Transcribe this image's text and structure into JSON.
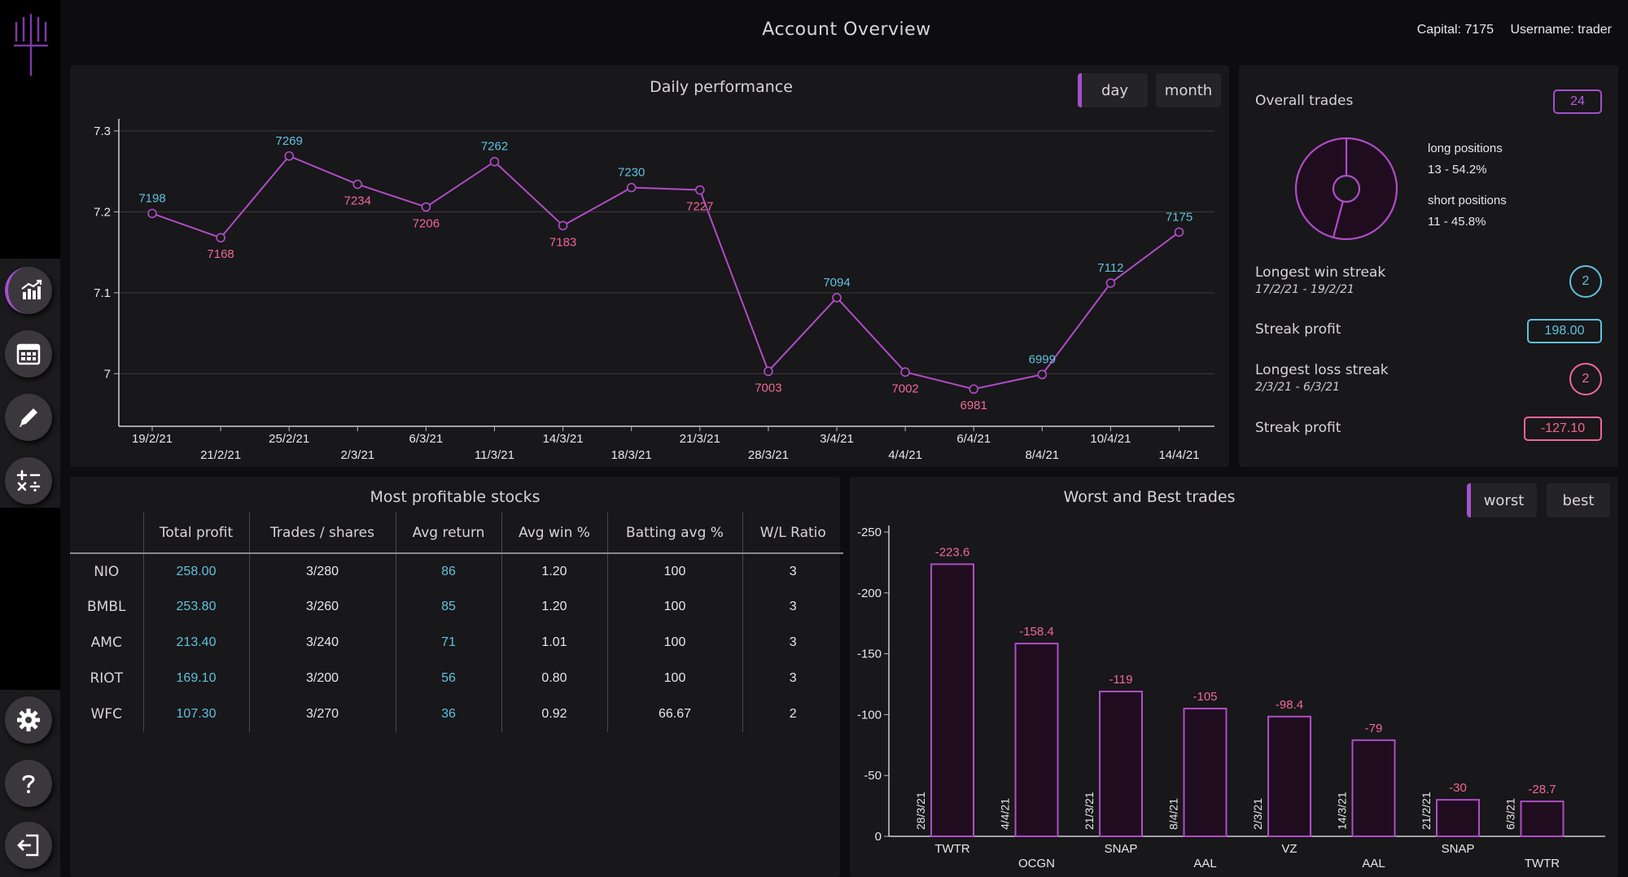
{
  "header": {
    "title": "Account Overview",
    "capital": "Capital: 7175",
    "username": "Username: trader"
  },
  "colors": {
    "accent": "#a44fd0",
    "line": "#b04cc8",
    "positive": "#5ec3e0",
    "negative": "#f0679a",
    "panel": "#181719"
  },
  "sidebar": {
    "items": [
      {
        "icon": "chart-icon",
        "active": true
      },
      {
        "icon": "calendar-icon",
        "active": false
      },
      {
        "icon": "pencil-icon",
        "active": false
      },
      {
        "icon": "calculator-icon",
        "active": false
      },
      {
        "icon": "gear-icon",
        "active": false
      },
      {
        "icon": "help-icon",
        "active": false
      },
      {
        "icon": "logout-icon",
        "active": false
      }
    ]
  },
  "daily": {
    "title": "Daily performance",
    "toggle_day": "day",
    "toggle_month": "month"
  },
  "summary": {
    "overall_label": "Overall trades",
    "overall_value": "24",
    "long_label": "long positions",
    "long_value": "13 - 54.2%",
    "short_label": "short positions",
    "short_value": "11 - 45.8%",
    "win_label": "Longest win streak",
    "win_dates": "17/2/21 - 19/2/21",
    "win_count": "2",
    "win_profit_label": "Streak profit",
    "win_profit": "198.00",
    "loss_label": "Longest loss streak",
    "loss_dates": "2/3/21 - 6/3/21",
    "loss_count": "2",
    "loss_profit_label": "Streak profit",
    "loss_profit": "-127.10"
  },
  "stocks": {
    "title": "Most profitable stocks",
    "columns": [
      "",
      "Total profit",
      "Trades / shares",
      "Avg return",
      "Avg win %",
      "Batting avg %",
      "W/L Ratio"
    ],
    "rows": [
      [
        "NIO",
        "258.00",
        "3/280",
        "86",
        "1.20",
        "100",
        "3"
      ],
      [
        "BMBL",
        "253.80",
        "3/260",
        "85",
        "1.20",
        "100",
        "3"
      ],
      [
        "AMC",
        "213.40",
        "3/240",
        "71",
        "1.01",
        "100",
        "3"
      ],
      [
        "RIOT",
        "169.10",
        "3/200",
        "56",
        "0.80",
        "100",
        "3"
      ],
      [
        "WFC",
        "107.30",
        "3/270",
        "36",
        "0.92",
        "66.67",
        "2"
      ]
    ]
  },
  "trades": {
    "title": "Worst and Best trades",
    "toggle_worst": "worst",
    "toggle_best": "best"
  },
  "chart_data": [
    {
      "type": "line",
      "title": "Daily performance",
      "x": [
        "19/2/21",
        "21/2/21",
        "25/2/21",
        "2/3/21",
        "6/3/21",
        "11/3/21",
        "14/3/21",
        "18/3/21",
        "21/3/21",
        "28/3/21",
        "3/4/21",
        "4/4/21",
        "6/4/21",
        "8/4/21",
        "10/4/21",
        "14/4/21"
      ],
      "values": [
        7198,
        7168,
        7269,
        7234,
        7206,
        7262,
        7183,
        7230,
        7227,
        7003,
        7094,
        7002,
        6981,
        6999,
        7112,
        7175
      ],
      "label_colors": [
        "pos",
        "neg",
        "pos",
        "neg",
        "neg",
        "pos",
        "neg",
        "pos",
        "neg",
        "neg",
        "pos",
        "neg",
        "neg",
        "pos",
        "pos",
        "pos"
      ],
      "yticks": [
        "7",
        "7.1",
        "7.2",
        "7.3"
      ],
      "ytick_values": [
        7000,
        7100,
        7200,
        7300
      ],
      "ylim": [
        6935,
        7315
      ],
      "grid": true
    },
    {
      "type": "bar",
      "title": "Worst and Best trades",
      "categories": [
        "TWTR",
        "OCGN",
        "SNAP",
        "AAL",
        "VZ",
        "AAL",
        "SNAP",
        "TWTR"
      ],
      "dates": [
        "28/3/21",
        "4/4/21",
        "21/3/21",
        "8/4/21",
        "2/3/21",
        "14/3/21",
        "21/2/21",
        "6/3/21"
      ],
      "values": [
        -223.6,
        -158.4,
        -119,
        -105,
        -98.4,
        -79,
        -30,
        -28.7
      ],
      "labels": [
        "-223.6",
        "-158.4",
        "-119",
        "-105",
        "-98.4",
        "-79",
        "-30",
        "-28.7"
      ],
      "yticks": [
        "0",
        "-50",
        "-100",
        "-150",
        "-200",
        "-250"
      ],
      "ytick_values": [
        0,
        -50,
        -100,
        -150,
        -200,
        -250
      ],
      "ylim": [
        0,
        -250
      ]
    },
    {
      "type": "pie",
      "title": "Overall trades",
      "categories": [
        "long positions",
        "short positions"
      ],
      "values": [
        13,
        11
      ]
    }
  ]
}
